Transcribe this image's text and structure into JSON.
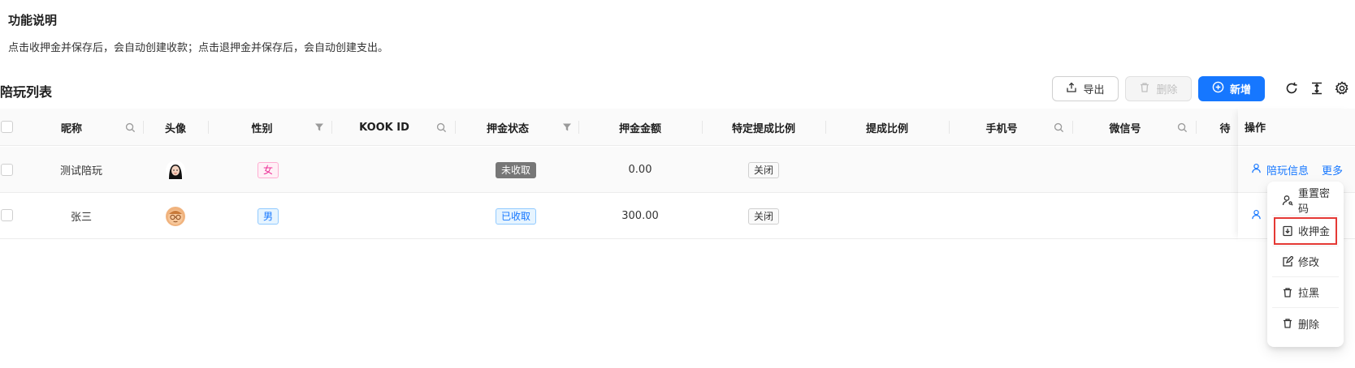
{
  "intro": {
    "title": "功能说明",
    "description": "点击收押金并保存后，会自动创建收款；点击退押金并保存后，会自动创建支出。"
  },
  "toolbar": {
    "title": "陪玩列表",
    "export_label": "导出",
    "delete_label": "删除",
    "add_label": "新增",
    "icons": [
      "refresh-icon",
      "column-height-icon",
      "settings-icon"
    ]
  },
  "table": {
    "columns": [
      "昵称",
      "头像",
      "性别",
      "KOOK ID",
      "押金状态",
      "押金金额",
      "特定提成比例",
      "提成比例",
      "手机号",
      "微信号",
      "待",
      "操作"
    ],
    "rows": [
      {
        "nickname": "测试陪玩",
        "avatar": "avatar-icon",
        "gender": "女",
        "kook_id": "",
        "deposit_status": "未收取",
        "deposit_amount": "0.00",
        "special_ratio": "关闭",
        "commission_ratio": "",
        "phone": "",
        "wechat": "",
        "action_info": "陪玩信息",
        "action_more": "更多"
      },
      {
        "nickname": "张三",
        "avatar": "avatar-icon",
        "gender": "男",
        "kook_id": "",
        "deposit_status": "已收取",
        "deposit_amount": "300.00",
        "special_ratio": "关闭",
        "commission_ratio": "",
        "phone": "",
        "wechat": "",
        "action_info": "",
        "action_more": ""
      }
    ]
  },
  "dropdown": {
    "items": [
      {
        "label": "重置密码",
        "icon": "key-user-icon"
      },
      {
        "label": "收押金",
        "icon": "deposit-icon"
      },
      {
        "label": "修改",
        "icon": "edit-icon"
      },
      {
        "label": "拉黑",
        "icon": "trash-icon"
      },
      {
        "label": "删除",
        "icon": "trash-icon"
      }
    ],
    "highlighted_index": 1
  },
  "colors": {
    "primary": "#1677ff",
    "highlight_border": "#e53935"
  }
}
